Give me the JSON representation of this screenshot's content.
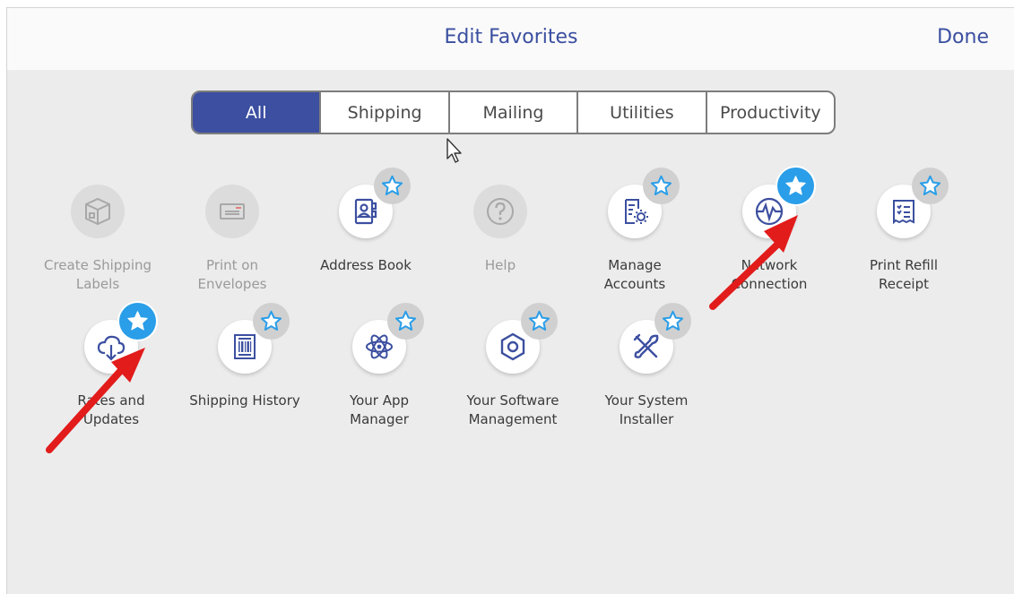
{
  "header": {
    "title": "Edit Favorites",
    "done_label": "Done"
  },
  "tabs": [
    {
      "label": "All",
      "active": true
    },
    {
      "label": "Shipping"
    },
    {
      "label": "Mailing"
    },
    {
      "label": "Utilities"
    },
    {
      "label": "Productivity"
    }
  ],
  "apps": [
    {
      "line1": "Create Shipping",
      "line2": "Labels",
      "icon": "package-icon",
      "enabled": false,
      "favorite": null
    },
    {
      "line1": "Print on",
      "line2": "Envelopes",
      "icon": "envelope-icon",
      "enabled": false,
      "favorite": null
    },
    {
      "line1": "Address Book",
      "line2": "",
      "icon": "address-book-icon",
      "enabled": true,
      "favorite": false
    },
    {
      "line1": "Help",
      "line2": "",
      "icon": "help-icon",
      "enabled": false,
      "favorite": null
    },
    {
      "line1": "Manage",
      "line2": "Accounts",
      "icon": "manage-accounts-icon",
      "enabled": true,
      "favorite": false
    },
    {
      "line1": "Network",
      "line2": "Connection",
      "icon": "network-icon",
      "enabled": true,
      "favorite": true
    },
    {
      "line1": "Print Refill",
      "line2": "Receipt",
      "icon": "receipt-icon",
      "enabled": true,
      "favorite": false
    },
    {
      "line1": "Rates and",
      "line2": "Updates",
      "icon": "cloud-download-icon",
      "enabled": true,
      "favorite": true
    },
    {
      "line1": "Shipping History",
      "line2": "",
      "icon": "barcode-icon",
      "enabled": true,
      "favorite": false
    },
    {
      "line1": "Your App",
      "line2": "Manager",
      "icon": "atom-icon",
      "enabled": true,
      "favorite": false
    },
    {
      "line1": "Your Software",
      "line2": "Management",
      "icon": "software-icon",
      "enabled": true,
      "favorite": false
    },
    {
      "line1": "Your System",
      "line2": "Installer",
      "icon": "tools-icon",
      "enabled": true,
      "favorite": false
    }
  ],
  "colors": {
    "accent": "#3c4fa0",
    "star_on": "#2a9ee8",
    "star_off": "#d0d0d0",
    "arrow": "#e21b1b"
  }
}
